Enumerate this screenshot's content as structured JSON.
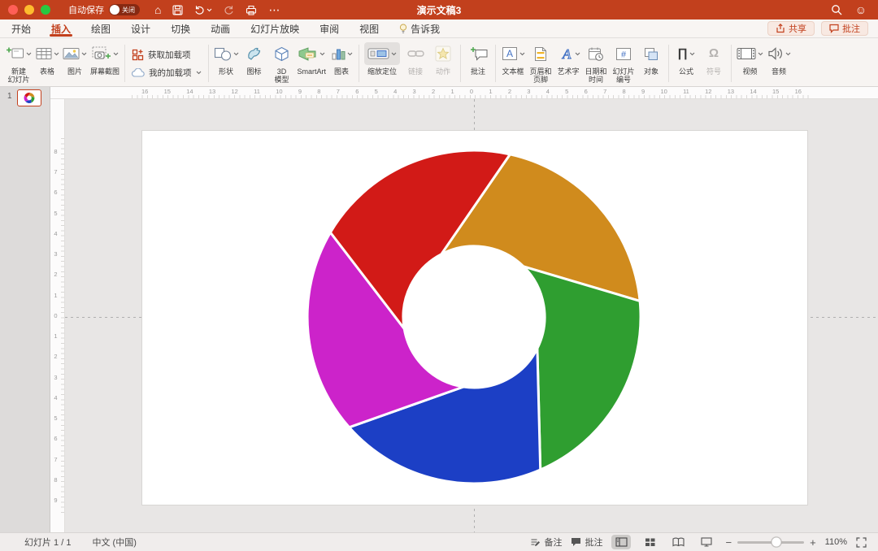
{
  "titlebar": {
    "autosave_label": "自动保存",
    "autosave_state": "关闭",
    "title": "演示文稿3"
  },
  "menubar": {
    "tabs": [
      {
        "label": "开始"
      },
      {
        "label": "插入"
      },
      {
        "label": "绘图"
      },
      {
        "label": "设计"
      },
      {
        "label": "切换"
      },
      {
        "label": "动画"
      },
      {
        "label": "幻灯片放映"
      },
      {
        "label": "审阅"
      },
      {
        "label": "视图"
      },
      {
        "label": "告诉我"
      }
    ],
    "selected_tab": "插入",
    "share_label": "共享",
    "comments_label": "批注"
  },
  "ribbon": {
    "items": [
      {
        "label": "新建\n幻灯片"
      },
      {
        "label": "表格"
      },
      {
        "label": "图片"
      },
      {
        "label": "屏幕截图"
      },
      {
        "label": "获取加载项"
      },
      {
        "label": "我的加载项"
      },
      {
        "label": "形状"
      },
      {
        "label": "图标"
      },
      {
        "label": "3D\n模型"
      },
      {
        "label": "SmartArt"
      },
      {
        "label": "图表"
      },
      {
        "label": "缩放定位"
      },
      {
        "label": "链接"
      },
      {
        "label": "动作"
      },
      {
        "label": "批注"
      },
      {
        "label": "文本框"
      },
      {
        "label": "页眉和\n页脚"
      },
      {
        "label": "艺术字"
      },
      {
        "label": "日期和\n时间"
      },
      {
        "label": "幻灯片\n编号"
      },
      {
        "label": "对象"
      },
      {
        "label": "公式"
      },
      {
        "label": "符号"
      },
      {
        "label": "视频"
      },
      {
        "label": "音频"
      }
    ]
  },
  "icons": {
    "home": "⌂",
    "more": "⋯",
    "smiley": "☺",
    "equation": "∏",
    "symbol": "Ω",
    "textbox_letter": "A",
    "wordart_letter": "A",
    "number_sign": "#",
    "minus": "−",
    "plus": "+"
  },
  "slide_panel": {
    "slide_number": "1"
  },
  "rulers": {
    "horizontal": [
      "16",
      "15",
      "14",
      "13",
      "12",
      "11",
      "10",
      "9",
      "8",
      "7",
      "6",
      "5",
      "4",
      "3",
      "2",
      "1",
      "0",
      "1",
      "2",
      "3",
      "4",
      "5",
      "6",
      "7",
      "8",
      "9",
      "10",
      "11",
      "12",
      "13",
      "14",
      "15",
      "16"
    ],
    "vertical": [
      "8",
      "7",
      "6",
      "5",
      "4",
      "3",
      "2",
      "1",
      "0",
      "1",
      "2",
      "3",
      "4",
      "5",
      "6",
      "7",
      "8",
      "9"
    ]
  },
  "slide": {
    "graphic": {
      "name": "aperture-pinwheel",
      "colors": {
        "red": "#D21A17",
        "orange": "#D08B1D",
        "green": "#2F9E30",
        "blue": "#1C3FC5",
        "magenta": "#CC23CA"
      }
    }
  },
  "statusbar": {
    "slide_indicator": "幻灯片 1 / 1",
    "language": "中文 (中国)",
    "notes_label": "备注",
    "comments_label": "批注",
    "zoom_level": "110%"
  },
  "theme": {
    "accent_red": "#C2401D",
    "titlebar_bg": "#C2401D"
  }
}
